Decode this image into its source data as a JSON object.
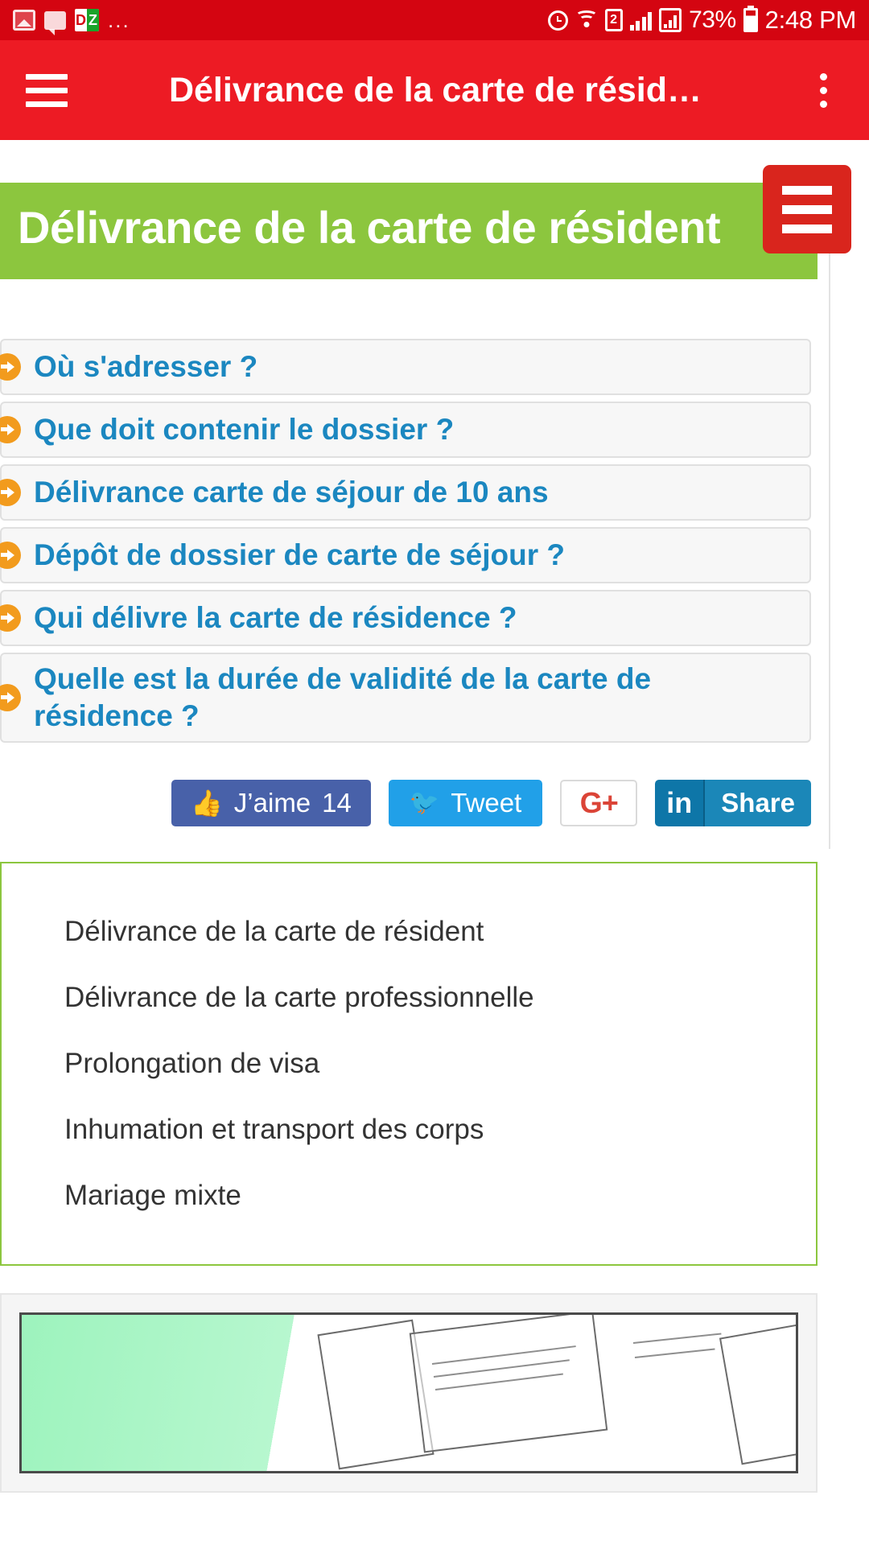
{
  "status_bar": {
    "icons_left": [
      "photo-icon",
      "chat-icon",
      "dz-app-icon",
      "more-notifications-icon"
    ],
    "dz_left": "D",
    "dz_right": "Z",
    "overflow_ellipsis": "...",
    "sim_number": "2",
    "battery_percent": "73%",
    "time": "2:48 PM"
  },
  "app_bar": {
    "title": "Délivrance de la carte de résid…",
    "menu_icon": "hamburger-icon",
    "overflow_icon": "vertical-dots-icon",
    "background_color": "#ed1b24"
  },
  "floating_menu": {
    "icon": "hamburger-icon",
    "background_color": "#d9251d"
  },
  "hero": {
    "title": "Délivrance de la carte de résident",
    "background_color": "#8cc63e"
  },
  "links": [
    {
      "label": "Où s'adresser ?"
    },
    {
      "label": "Que doit contenir le dossier ?"
    },
    {
      "label": "Délivrance carte de séjour de 10 ans"
    },
    {
      "label": "Dépôt de dossier de carte de séjour ?"
    },
    {
      "label": "Qui délivre la carte de résidence ?"
    },
    {
      "label": "Quelle est la durée de validité de la carte de résidence ?"
    }
  ],
  "link_accent_color": "#1b87c0",
  "bullet_color": "#f29b1d",
  "social": {
    "facebook": {
      "label": "J’aime",
      "count": "14",
      "icon": "thumbs-up-icon",
      "color": "#4861a9"
    },
    "twitter": {
      "label": "Tweet",
      "icon": "twitter-bird-icon",
      "color": "#21a0e8"
    },
    "google_plus": {
      "label": "G+",
      "icon": "google-plus-icon",
      "color": "#db4437"
    },
    "linkedin": {
      "mark": "in",
      "label": "Share",
      "icon": "linkedin-icon",
      "color": "#0e76a8"
    }
  },
  "related": {
    "border_color": "#8cc63e",
    "items": [
      {
        "label": "Délivrance de la carte de résident"
      },
      {
        "label": "Délivrance de la carte professionnelle"
      },
      {
        "label": "Prolongation de visa"
      },
      {
        "label": "Inhumation et transport des corps"
      },
      {
        "label": "Mariage mixte"
      }
    ]
  },
  "bottom_media": {
    "name": "document-scan-thumbnail"
  }
}
